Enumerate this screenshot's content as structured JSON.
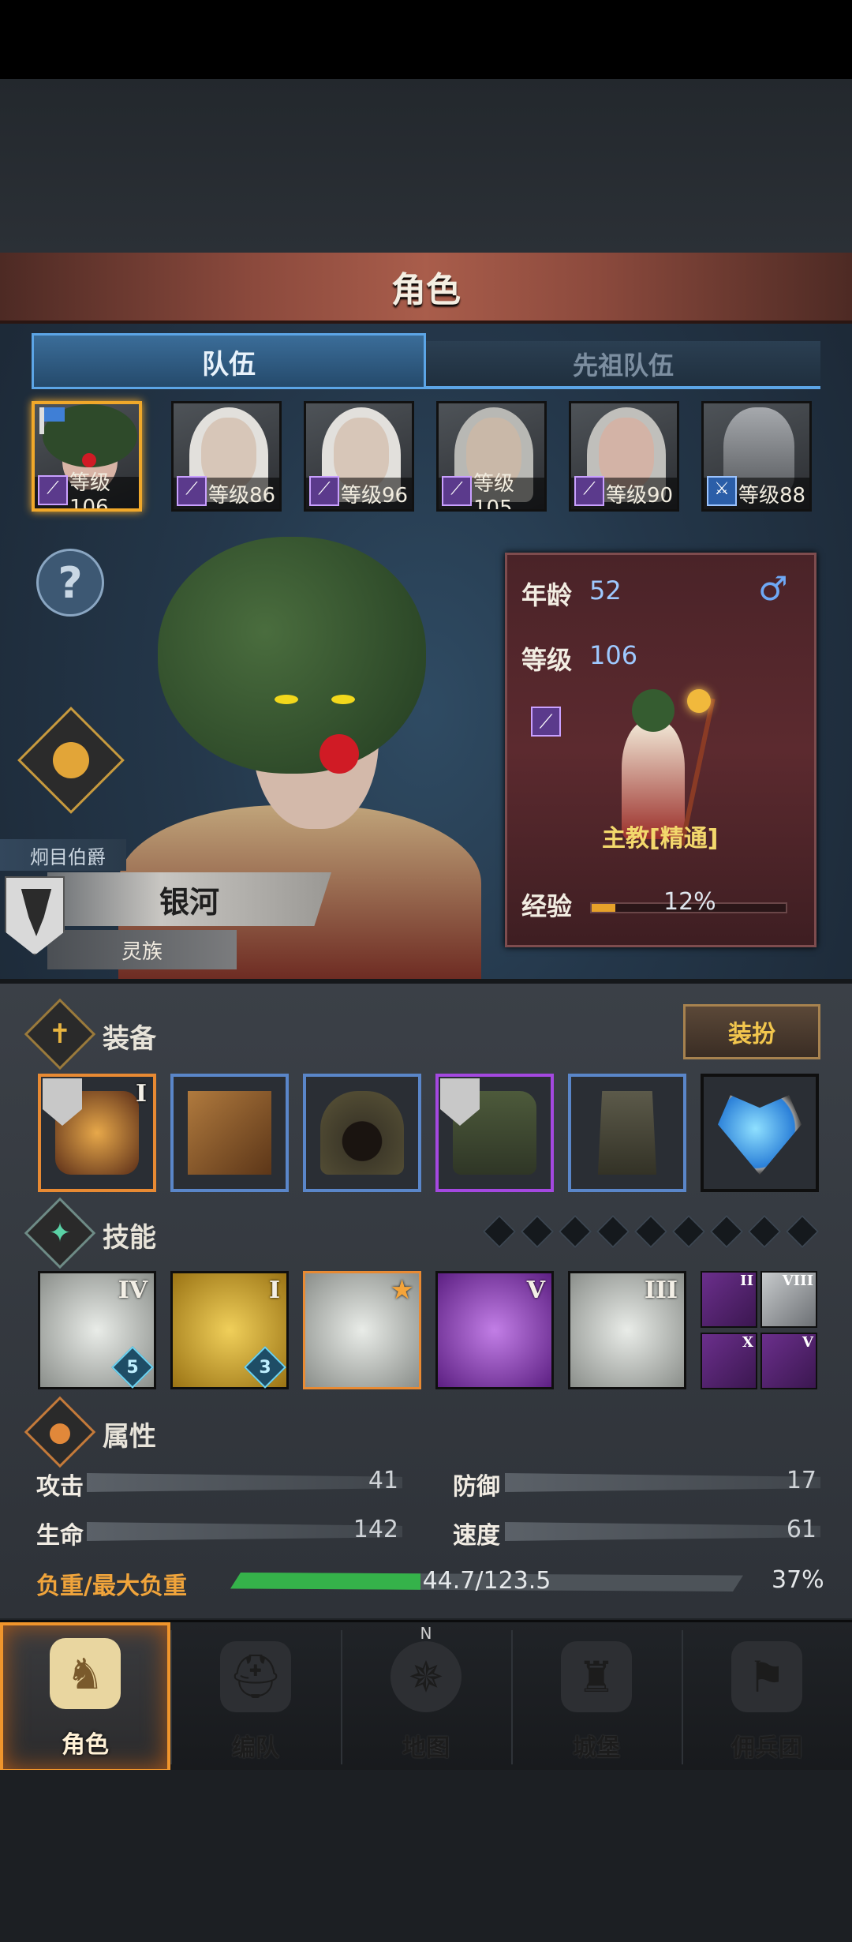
{
  "header": {
    "title": "角色"
  },
  "tabs": [
    {
      "label": "队伍",
      "active": true
    },
    {
      "label": "先祖队伍",
      "active": false
    }
  ],
  "party": [
    {
      "level_label": "等级106",
      "selected": true,
      "look": "green-afro",
      "flag": true,
      "class_icon": "wand-icon"
    },
    {
      "level_label": "等级86",
      "selected": false,
      "look": "white-hair",
      "class_icon": "wand-icon"
    },
    {
      "level_label": "等级96",
      "selected": false,
      "look": "white-hair",
      "class_icon": "wand-icon"
    },
    {
      "level_label": "等级105",
      "selected": false,
      "look": "grey-hair",
      "class_icon": "wand-icon"
    },
    {
      "level_label": "等级90",
      "selected": false,
      "look": "grey-hair",
      "class_icon": "wand-icon"
    },
    {
      "level_label": "等级88",
      "selected": false,
      "look": "helmet",
      "class_icon": "sword-icon"
    }
  ],
  "character": {
    "title": "炯目伯爵",
    "name": "银河",
    "race": "灵族",
    "age_label": "年龄",
    "age": "52",
    "gender": "♂",
    "level_label": "等级",
    "level": "106",
    "class_name": "主教[精通]",
    "exp_label": "经验",
    "exp_percent": "12%",
    "exp_fraction": 0.12
  },
  "equipment": {
    "section_title": "装备",
    "dress_button": "装扮",
    "slots": [
      {
        "item": "staff",
        "rarity": "orange",
        "tier": "I",
        "crest": true
      },
      {
        "item": "book",
        "rarity": "blue",
        "tier": "",
        "crest": false
      },
      {
        "item": "hood",
        "rarity": "blue",
        "tier": "",
        "crest": false
      },
      {
        "item": "robe",
        "rarity": "purple",
        "tier": "",
        "crest": true
      },
      {
        "item": "boots",
        "rarity": "blue",
        "tier": "",
        "crest": false
      },
      {
        "item": "amulet",
        "rarity": "black",
        "tier": "",
        "crest": false
      }
    ]
  },
  "skills": {
    "section_title": "技能",
    "diamond_count": 9,
    "slots": [
      {
        "tier": "IV",
        "count": "5",
        "bg": "light",
        "border": "black"
      },
      {
        "tier": "I",
        "count": "3",
        "bg": "gold",
        "border": "black"
      },
      {
        "tier": "",
        "count": "",
        "bg": "light",
        "border": "orange",
        "star": true
      },
      {
        "tier": "V",
        "count": "",
        "bg": "purple",
        "border": "black"
      },
      {
        "tier": "III",
        "count": "",
        "bg": "light",
        "border": "black"
      }
    ],
    "mini": [
      {
        "tier": "II",
        "style": "purple"
      },
      {
        "tier": "VIII",
        "style": "light"
      },
      {
        "tier": "X",
        "style": "purple"
      },
      {
        "tier": "V",
        "style": "purple"
      }
    ]
  },
  "attributes": {
    "section_title": "属性",
    "stats": [
      {
        "label": "攻击",
        "value": "41"
      },
      {
        "label": "防御",
        "value": "17"
      },
      {
        "label": "生命",
        "value": "142"
      },
      {
        "label": "速度",
        "value": "61"
      }
    ],
    "load_label": "负重/最大负重",
    "load_text": "44.7/123.5",
    "load_percent": "37%",
    "load_fraction": 0.37
  },
  "nav": [
    {
      "label": "角色",
      "icon": "knight-icon",
      "active": true
    },
    {
      "label": "编队",
      "icon": "helmet-icon",
      "active": false
    },
    {
      "label": "地图",
      "icon": "compass-icon",
      "active": false,
      "north": "N"
    },
    {
      "label": "城堡",
      "icon": "castle-icon",
      "active": false
    },
    {
      "label": "佣兵团",
      "icon": "mercenary-icon",
      "active": false
    }
  ],
  "colors": {
    "accent_blue": "#5ca5e6",
    "selected_gold": "#f0a82a",
    "load_green": "#35b24a",
    "load_orange": "#f0a43b"
  }
}
